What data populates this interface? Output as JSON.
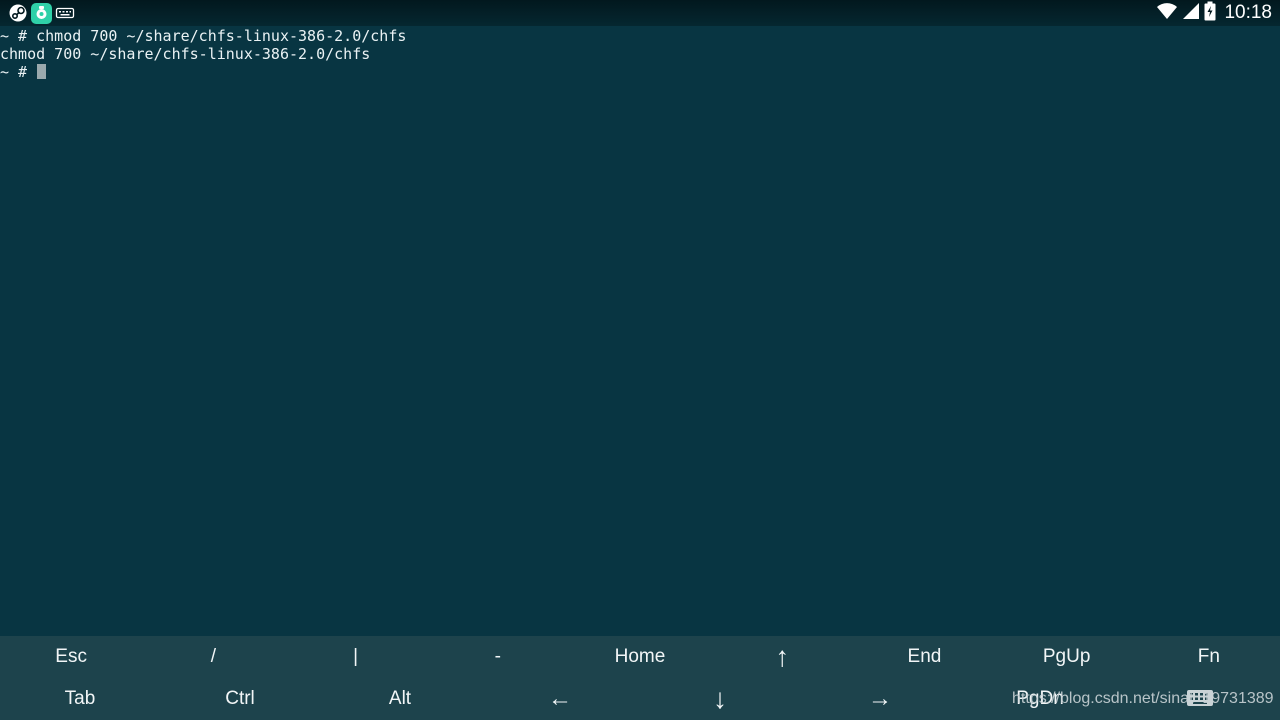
{
  "status_bar": {
    "notification_icons": [
      "steam-icon",
      "app-store-icon",
      "keyboard-icon"
    ],
    "system_icons": [
      "wifi-icon",
      "signal-icon",
      "battery-charging-icon"
    ],
    "time": "10:18"
  },
  "terminal": {
    "lines": [
      {
        "text": "~ # chmod 700 ~/share/chfs-linux-386-2.0/chfs"
      },
      {
        "text": "chmod 700 ~/share/chfs-linux-386-2.0/chfs"
      },
      {
        "text": "~ # "
      }
    ],
    "colors": {
      "background": "#083542",
      "text": "#eaf2f4",
      "cursor": "#9aa9ad"
    }
  },
  "extra_keys": {
    "row1": [
      {
        "label": "Esc"
      },
      {
        "label": "/"
      },
      {
        "label": "|"
      },
      {
        "label": "-"
      },
      {
        "label": "Home"
      },
      {
        "label": "↑"
      },
      {
        "label": "End"
      },
      {
        "label": "PgUp"
      },
      {
        "label": "Fn"
      }
    ],
    "row2": [
      {
        "label": "Tab"
      },
      {
        "label": "Ctrl"
      },
      {
        "label": "Alt"
      },
      {
        "label": "←"
      },
      {
        "label": "↓"
      },
      {
        "label": "→"
      },
      {
        "label": "PgDn"
      }
    ],
    "background": "#1d434c"
  },
  "watermark": {
    "text": "https://blog.csdn.net/sinat_19731389"
  },
  "keyboard_toggle": {
    "icon": "keyboard-icon"
  }
}
